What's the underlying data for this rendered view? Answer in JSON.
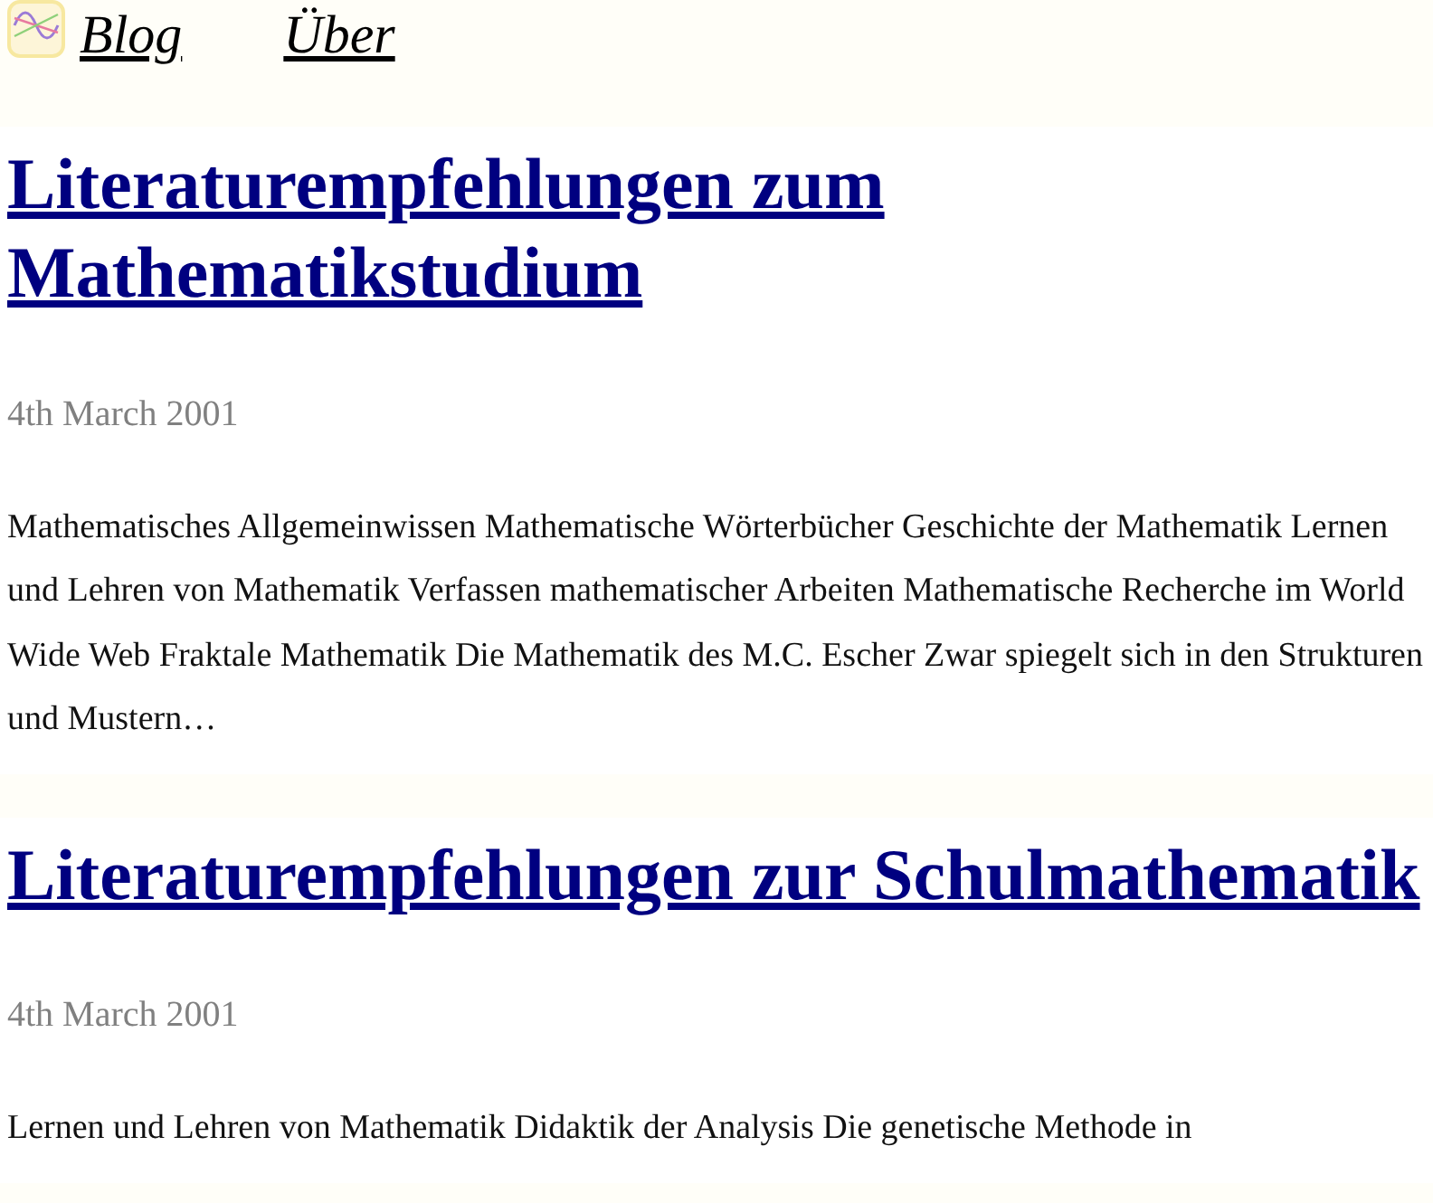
{
  "nav": [
    {
      "label": "Blog"
    },
    {
      "label": "Über"
    }
  ],
  "posts": [
    {
      "title": "Literaturempfehlungen zum Mathematikstudium",
      "date": "4th March 2001",
      "excerpt": "Mathematisches Allgemeinwissen Mathematische Wörterbücher Geschichte der Mathematik Lernen und Lehren von Mathematik Verfassen mathematischer Arbeiten Mathematische Recherche im World Wide Web Fraktale Mathematik Die Mathematik des M.C. Escher Zwar spiegelt sich in den Strukturen und Mustern…"
    },
    {
      "title": "Literaturempfehlungen zur Schulmathematik",
      "date": "4th March 2001",
      "excerpt": "Lernen und Lehren von Mathematik Didaktik der Analysis Die genetische Methode in"
    }
  ]
}
